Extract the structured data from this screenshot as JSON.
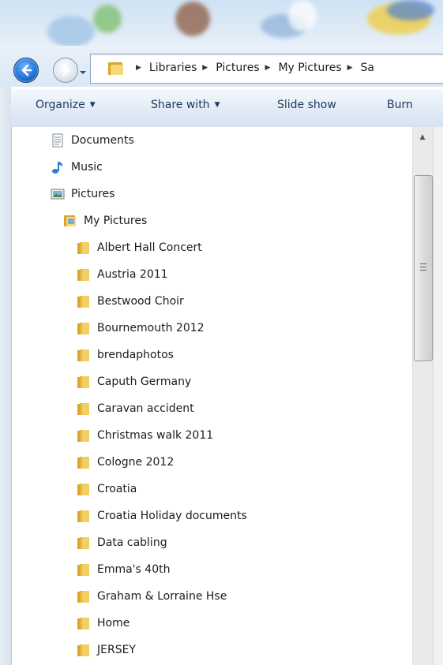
{
  "breadcrumb": [
    "Libraries",
    "Pictures",
    "My Pictures",
    "Sa"
  ],
  "toolbar": {
    "organize": "Organize",
    "share_with": "Share with",
    "slide_show": "Slide show",
    "burn": "Burn"
  },
  "tree": {
    "documents": "Documents",
    "music": "Music",
    "pictures": "Pictures",
    "my_pictures": "My Pictures",
    "folders": [
      "Albert Hall Concert",
      "Austria 2011",
      "Bestwood Choir",
      "Bournemouth 2012",
      "brendaphotos",
      "Caputh Germany",
      "Caravan accident",
      "Christmas walk 2011",
      "Cologne 2012",
      "Croatia",
      "Croatia Holiday documents",
      "Data cabling",
      "Emma's 40th",
      "Graham & Lorraine Hse",
      "Home",
      "JERSEY"
    ]
  },
  "colors": {
    "folder": "#e8b73a",
    "command_text": "#1e395b",
    "window_frame": "#d5e3f1"
  }
}
